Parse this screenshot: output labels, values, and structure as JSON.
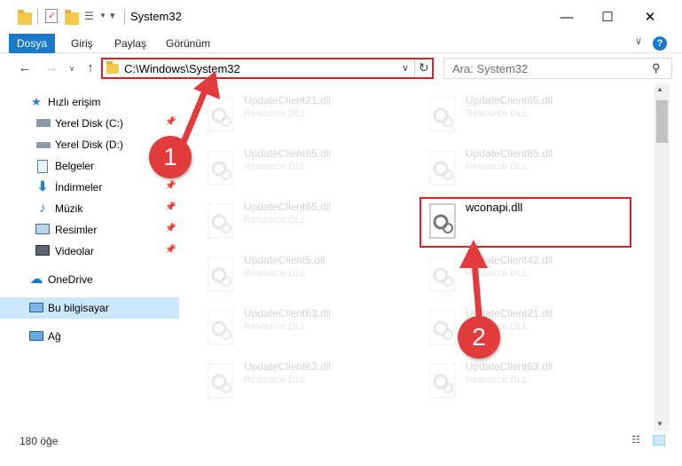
{
  "window": {
    "title": "System32",
    "minimize": "—",
    "maximize": "☐",
    "close": "✕"
  },
  "ribbon": {
    "file_tab": "Dosya",
    "tabs": [
      "Giriş",
      "Paylaş",
      "Görünüm"
    ]
  },
  "navbar": {
    "address": "C:\\Windows\\System32",
    "search_placeholder": "Ara: System32"
  },
  "sidebar": {
    "items": [
      {
        "label": "Hızlı erişim",
        "icon": "star-icon",
        "pinned": false
      },
      {
        "label": "Yerel Disk (C:)",
        "icon": "drive-c-icon",
        "pinned": true
      },
      {
        "label": "Yerel Disk (D:)",
        "icon": "drive-d-icon",
        "pinned": true
      },
      {
        "label": "Belgeler",
        "icon": "documents-icon",
        "pinned": true
      },
      {
        "label": "İndirmeler",
        "icon": "downloads-icon",
        "pinned": true
      },
      {
        "label": "Müzik",
        "icon": "music-icon",
        "pinned": true
      },
      {
        "label": "Resimler",
        "icon": "pictures-icon",
        "pinned": true
      },
      {
        "label": "Videolar",
        "icon": "videos-icon",
        "pinned": true
      },
      {
        "label": "OneDrive",
        "icon": "onedrive-icon",
        "pinned": false
      },
      {
        "label": "Bu bilgisayar",
        "icon": "this-pc-icon",
        "pinned": false
      },
      {
        "label": "Ağ",
        "icon": "network-icon",
        "pinned": false
      }
    ]
  },
  "files": {
    "left_column": [
      {
        "name": "UpdateClient21.dll",
        "type": "Resource DLL"
      },
      {
        "name": "UpdateClient65.dll",
        "type": "Resource DLL"
      },
      {
        "name": "UpdateClient65.dll",
        "type": "Resource DLL"
      },
      {
        "name": "UpdateClient5.dll",
        "type": "Resource DLL"
      },
      {
        "name": "UpdateClient63.dll",
        "type": "Resource DLL"
      },
      {
        "name": "UpdateClient63.dll",
        "type": "Resource DLL"
      }
    ],
    "right_column": [
      {
        "name": "UpdateClient65.dll",
        "type": "Resource DLL"
      },
      {
        "name": "UpdateClient65.dll",
        "type": "Resource DLL"
      },
      {
        "name": "wconapi.dll",
        "type": ""
      },
      {
        "name": "UpdateClient42.dll",
        "type": "Resource DLL"
      },
      {
        "name": "UpdateClient21.dll",
        "type": "Resource DLL"
      },
      {
        "name": "UpdateClient63.dll",
        "type": "Resource DLL"
      }
    ]
  },
  "status": {
    "item_count": "180 öğe"
  },
  "callouts": [
    {
      "number": "1"
    },
    {
      "number": "2"
    }
  ],
  "colors": {
    "accent": "#1979ca",
    "callout": "#e23b3b",
    "selection": "#cce8ff"
  }
}
